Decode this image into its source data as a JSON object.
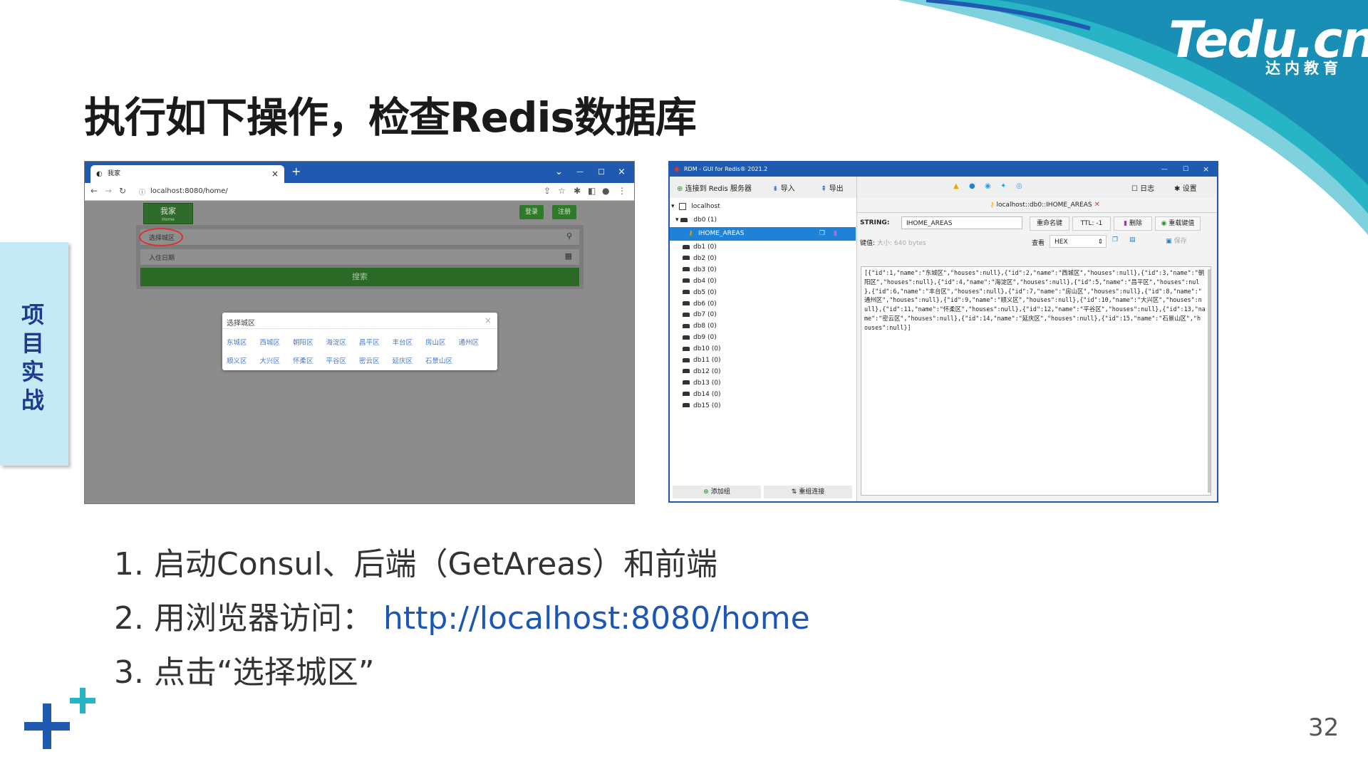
{
  "logo": {
    "main": "Tedu.cn",
    "sub": "达内教育"
  },
  "slide": {
    "title": "执行如下操作，检查Redis数据库",
    "side_tab": "项目实战",
    "page_number": "32",
    "steps": [
      {
        "num": "1.",
        "text": "启动Consul、后端（GetAreas）和前端"
      },
      {
        "num": "2.",
        "text": "用浏览器访问：",
        "link": "http://localhost:8080/home"
      },
      {
        "num": "3.",
        "text": "点击“选择城区”"
      }
    ]
  },
  "browser": {
    "tab_title": "我家",
    "new_tab": "+",
    "tab_close": "×",
    "url": "localhost:8080/home/",
    "window_buttons": [
      "⌄",
      "—",
      "☐",
      "×"
    ],
    "site_logo": "我家",
    "site_logo_sub": "Home",
    "login_label": "登录",
    "register_label": "注册",
    "area_placeholder": "选择城区",
    "date_placeholder": "入住日期",
    "search_label": "搜索",
    "popup": {
      "title": "选择城区",
      "close": "×",
      "areas_row1": [
        "东城区",
        "西城区",
        "朝阳区",
        "海淀区",
        "昌平区",
        "丰台区",
        "房山区",
        "通州区"
      ],
      "areas_row2": [
        "顺义区",
        "大兴区",
        "怀柔区",
        "平谷区",
        "密云区",
        "延庆区",
        "石景山区"
      ]
    }
  },
  "rdm": {
    "title": "RDM - GUI for Redis® 2021.2",
    "window_buttons": [
      "—",
      "☐",
      "×"
    ],
    "toolbar": {
      "connect": "连接到 Redis 服务器",
      "import": "导入",
      "export": "导出",
      "log": "日志",
      "settings": "设置"
    },
    "tree": {
      "server": "localhost",
      "databases": [
        "db0  (1)",
        "db1  (0)",
        "db2  (0)",
        "db3  (0)",
        "db4  (0)",
        "db5  (0)",
        "db6  (0)",
        "db7  (0)",
        "db8  (0)",
        "db9  (0)",
        "db10  (0)",
        "db11  (0)",
        "db12  (0)",
        "db13  (0)",
        "db14  (0)",
        "db15  (0)"
      ],
      "selected_key": "IHOME_AREAS",
      "add_group": "添加组",
      "reload": "重组连接"
    },
    "key_view": {
      "tab_label": "localhost::db0::IHOME_AREAS",
      "type": "STRING:",
      "key_name": "IHOME_AREAS",
      "rename": "重命名键",
      "ttl": "TTL: -1",
      "delete": "删除",
      "reload_value": "重载键值",
      "value_label": "键值:",
      "size": "大小: 640 bytes",
      "view_label": "查看",
      "view_mode": "HEX",
      "save": "保存",
      "value_lines": [
        "[{\"id\":1,\"name\":\"东城区\",\"houses\":null},{\"id\":2,\"name\":\"西城区\",\"houses\":null},{\"id\":3,\"name\":\"朝",
        "阳区\",\"houses\":null},{\"id\":4,\"name\":\"海淀区\",\"houses\":null},{\"id\":5,\"name\":\"昌平区\",\"houses\":nul",
        "},{\"id\":6,\"name\":\"丰台区\",\"houses\":null},{\"id\":7,\"name\":\"房山区\",\"houses\":null},{\"id\":8,\"name\":\"",
        "通州区\",\"houses\":null},{\"id\":9,\"name\":\"顺义区\",\"houses\":null},{\"id\":10,\"name\":\"大兴区\",\"houses\":n",
        "ull},{\"id\":11,\"name\":\"怀柔区\",\"houses\":null},{\"id\":12,\"name\":\"平谷区\",\"houses\":null},{\"id\":13,\"na",
        "me\":\"密云区\",\"houses\":null},{\"id\":14,\"name\":\"延庆区\",\"houses\":null},{\"id\":15,\"name\":\"石景山区\",\"h",
        "ouses\":null}]"
      ]
    }
  },
  "colors": {
    "accent_blue": "#1f5ab0",
    "site_green": "#2f6b2a",
    "teal": "#27b5c6",
    "link": "#1e56b5"
  }
}
